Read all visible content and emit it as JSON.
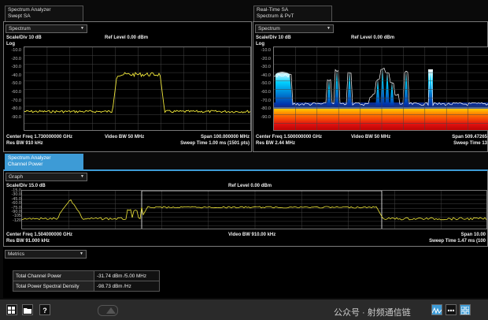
{
  "top_left": {
    "tab_line1": "Spectrum Analyzer",
    "tab_line2": "Swept SA",
    "view_select": "Spectrum",
    "scale_div": "Scale/Div 10 dB",
    "ref_level": "Ref Level 0.00 dBm",
    "log_label": "Log",
    "y_ticks": [
      "-10.0",
      "-20.0",
      "-30.0",
      "-40.0",
      "-50.0",
      "-60.0",
      "-70.0",
      "-80.0",
      "-90.0"
    ],
    "center_freq": "Center Freq 1.730000000 GHz",
    "video_bw": "Video BW 50 MHz",
    "span": "Span 100.000000 MHz",
    "res_bw": "Res BW 910 kHz",
    "sweep_time": "Sweep Time 1.00 ms (1501 pts)"
  },
  "top_right": {
    "tab_line1": "Real-Time SA",
    "tab_line2": "Spectrum & PvT",
    "view_select": "Spectrum",
    "scale_div": "Scale/Div 10 dB",
    "ref_level": "Ref Level 0.00 dBm",
    "log_label": "Log",
    "y_ticks": [
      "-10.0",
      "-20.0",
      "-30.0",
      "-40.0",
      "-50.0",
      "-60.0",
      "-70.0",
      "-80.0",
      "-90.0"
    ],
    "center_freq": "Center Freq 1.500000000 GHz",
    "video_bw": "Video BW 50 MHz",
    "span": "Span 509.47265",
    "res_bw": "Res BW 2.44 MHz",
    "sweep_time": "Sweep Time 13"
  },
  "bottom": {
    "tab_line1": "Spectrum Analyzer",
    "tab_line2": "Channel Power",
    "view_select": "Graph",
    "scale_div": "Scale/Div 15.0 dB",
    "ref_level": "Ref Level 0.00 dBm",
    "y_ticks": [
      "-15.0",
      "-30.0",
      "-45.0",
      "-60.0",
      "-75.0",
      "-90.0",
      "-105",
      "-120"
    ],
    "center_freq": "Center Freq 1.504000000 GHz",
    "video_bw": "Video BW 910.00 kHz",
    "span": "Span 10.00",
    "res_bw": "Res BW 91.000 kHz",
    "sweep_time": "Sweep Time 1.47 ms (100"
  },
  "metrics": {
    "select": "Metrics",
    "rows": [
      {
        "label": "Total Channel Power",
        "value": "-31.74 dBm /5.00 MHz"
      },
      {
        "label": "Total Power Spectral Density",
        "value": "-98.73 dBm /Hz"
      }
    ]
  },
  "taskbar": {
    "help_label": "?",
    "watermark": "公众号 · 射频通信链"
  }
}
